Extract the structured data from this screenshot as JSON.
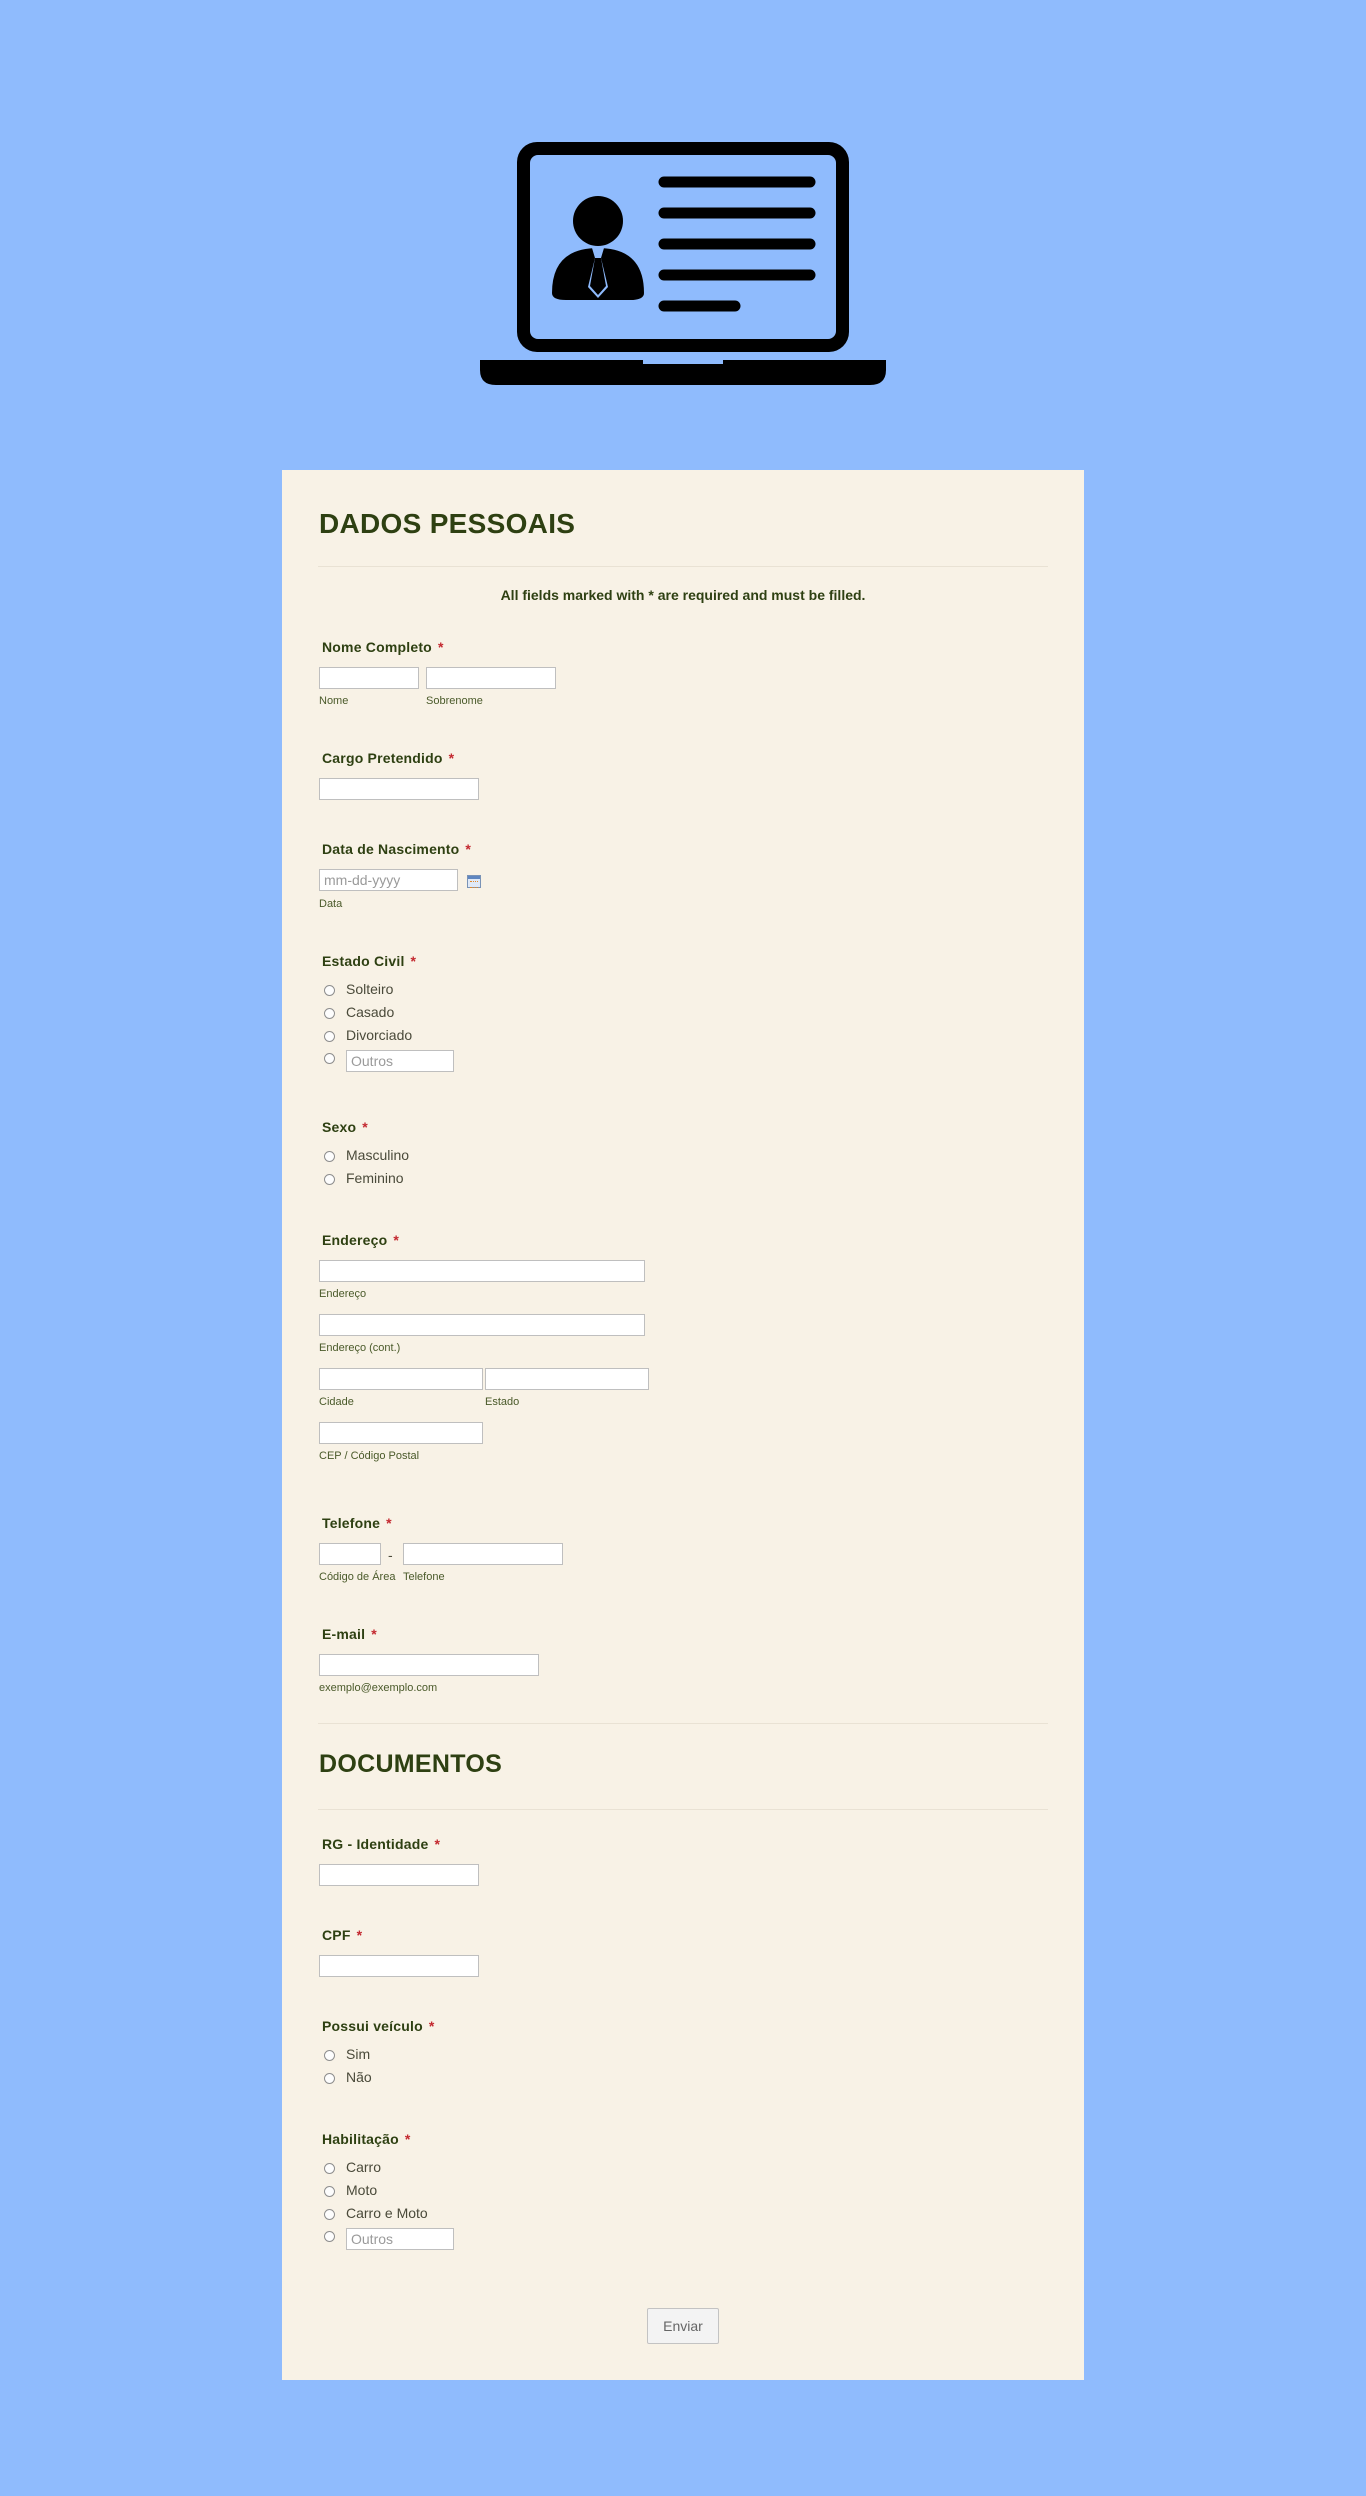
{
  "colors": {
    "page_background": "#8fbbfd",
    "card_background": "#f8f2e6",
    "title_color": "#2e4012",
    "required_mark": "#c3282f"
  },
  "header": {
    "icon": "laptop-resume-icon"
  },
  "sections": {
    "personal_title": "DADOS PESSOAIS",
    "documents_title": "DOCUMENTOS"
  },
  "required_note": "All fields marked with * are required and must be filled.",
  "required_mark": "*",
  "fields": {
    "nome": {
      "label": "Nome Completo",
      "first_sublabel": "Nome",
      "last_sublabel": "Sobrenome"
    },
    "cargo": {
      "label": "Cargo Pretendido"
    },
    "nascimento": {
      "label": "Data de Nascimento",
      "placeholder": "mm-dd-yyyy",
      "sublabel": "Data"
    },
    "estado_civil": {
      "label": "Estado Civil",
      "options": [
        "Solteiro",
        "Casado",
        "Divorciado"
      ],
      "other_placeholder": "Outros"
    },
    "sexo": {
      "label": "Sexo",
      "options": [
        "Masculino",
        "Feminino"
      ]
    },
    "endereco": {
      "label": "Endereço",
      "line1_sublabel": "Endereço",
      "line2_sublabel": "Endereço (cont.)",
      "city_sublabel": "Cidade",
      "state_sublabel": "Estado",
      "zip_sublabel": "CEP / Código Postal"
    },
    "telefone": {
      "label": "Telefone",
      "area_sublabel": "Código de Área",
      "phone_sublabel": "Telefone",
      "separator": "-"
    },
    "email": {
      "label": "E-mail",
      "sublabel": "exemplo@exemplo.com"
    },
    "rg": {
      "label": "RG - Identidade"
    },
    "cpf": {
      "label": "CPF"
    },
    "veiculo": {
      "label": "Possui veículo",
      "options": [
        "Sim",
        "Não"
      ]
    },
    "habilitacao": {
      "label": "Habilitação",
      "options": [
        "Carro",
        "Moto",
        "Carro e Moto"
      ],
      "other_placeholder": "Outros"
    }
  },
  "submit_label": "Enviar"
}
